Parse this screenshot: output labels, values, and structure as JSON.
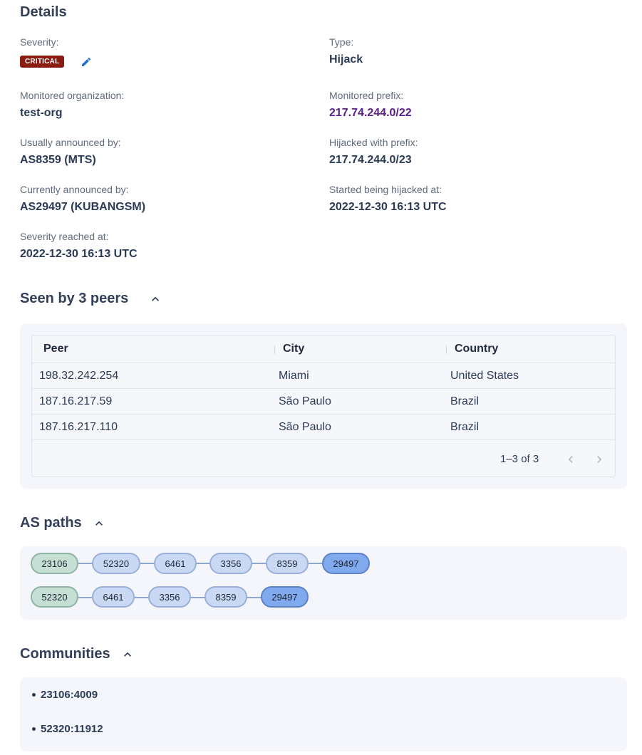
{
  "details": {
    "title": "Details",
    "severity_label": "Severity:",
    "severity_value": "CRITICAL",
    "type_label": "Type:",
    "type_value": "Hijack",
    "org_label": "Monitored organization:",
    "org_value": "test-org",
    "prefix_label": "Monitored prefix:",
    "prefix_value": "217.74.244.0/22",
    "usual_label": "Usually announced by:",
    "usual_value": "AS8359 (MTS)",
    "hijacked_prefix_label": "Hijacked with prefix:",
    "hijacked_prefix_value": "217.74.244.0/23",
    "current_label": "Currently announced by:",
    "current_value": "AS29497 (KUBANGSM)",
    "started_label": "Started being hijacked at:",
    "started_value": "2022-12-30 16:13 UTC",
    "severity_reached_label": "Severity reached at:",
    "severity_reached_value": "2022-12-30 16:13 UTC"
  },
  "peers": {
    "title": "Seen by 3 peers",
    "columns": [
      "Peer",
      "City",
      "Country"
    ],
    "rows": [
      [
        "198.32.242.254",
        "Miami",
        "United States"
      ],
      [
        "187.16.217.59",
        "São Paulo",
        "Brazil"
      ],
      [
        "187.16.217.110",
        "São Paulo",
        "Brazil"
      ]
    ],
    "pagination": "1–3 of 3"
  },
  "as_paths": {
    "title": "AS paths",
    "paths": [
      [
        "23106",
        "52320",
        "6461",
        "3356",
        "8359",
        "29497"
      ],
      [
        "52320",
        "6461",
        "3356",
        "8359",
        "29497"
      ]
    ]
  },
  "communities": {
    "title": "Communities",
    "items": [
      "23106:4009",
      "52320:11912"
    ]
  },
  "colors": {
    "critical": "#8a1c12",
    "prefix_link": "#5a1f84",
    "origin_node": "#c6dfd4",
    "transit_node": "#c9d9f4",
    "target_node": "#80a9ee"
  }
}
